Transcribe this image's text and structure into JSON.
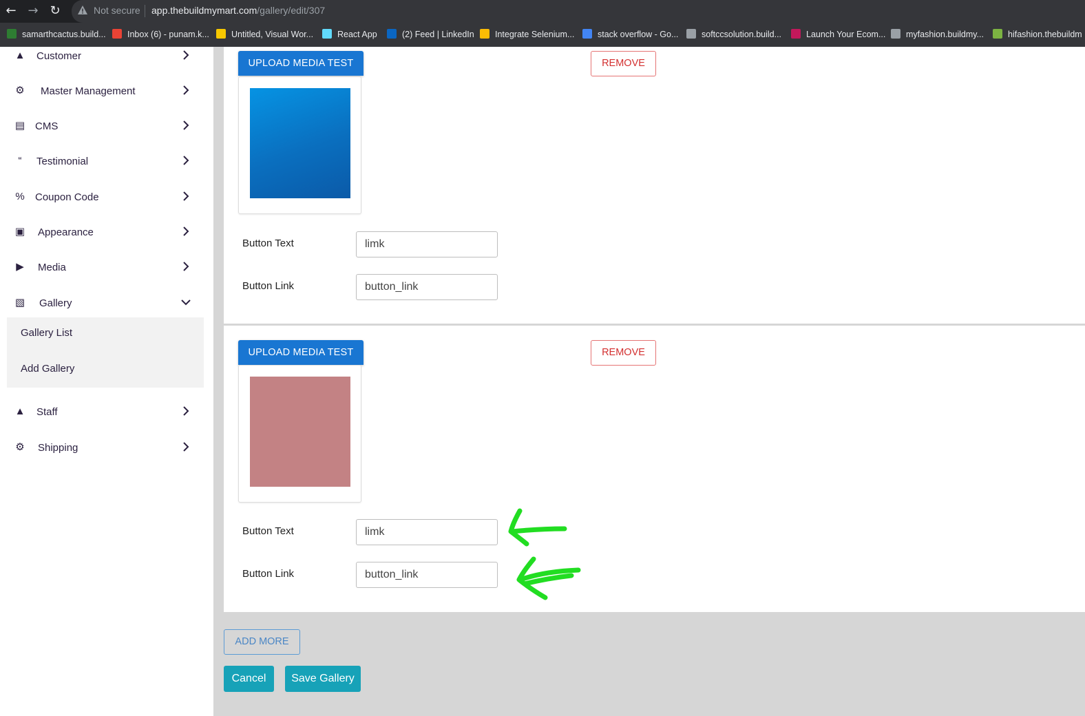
{
  "browser": {
    "not_secure": "Not secure",
    "url_host": "app.thebuildmymart.com",
    "url_path": "/gallery/edit/307",
    "bookmarks": [
      {
        "label": "samarthcactus.build...",
        "icon": "site-icon",
        "color": "#2e7d32"
      },
      {
        "label": "Inbox (6) - punam.k...",
        "icon": "gmail-icon",
        "color": "#ea4335"
      },
      {
        "label": "Untitled, Visual Wor...",
        "icon": "miro-icon",
        "color": "#f7c800"
      },
      {
        "label": "React App",
        "icon": "react-icon",
        "color": "#61dafb"
      },
      {
        "label": "(2) Feed | LinkedIn",
        "icon": "linkedin-icon",
        "color": "#0a66c2"
      },
      {
        "label": "Integrate Selenium...",
        "icon": "chrome-icon",
        "color": "#fbbc05"
      },
      {
        "label": "stack overflow - Go...",
        "icon": "google-icon",
        "color": "#4285f4"
      },
      {
        "label": "softccsolution.build...",
        "icon": "globe-icon",
        "color": "#9aa0a6"
      },
      {
        "label": "Launch Your Ecom...",
        "icon": "store-icon",
        "color": "#c2185b"
      },
      {
        "label": "myfashion.buildmy...",
        "icon": "globe-icon",
        "color": "#9aa0a6"
      },
      {
        "label": "hifashion.thebuildm",
        "icon": "leaf-icon",
        "color": "#7cb342"
      }
    ]
  },
  "sidebar": {
    "items": [
      {
        "label": "Customer",
        "icon": "user-icon",
        "glyph": "▲"
      },
      {
        "label": "Master Management",
        "icon": "user-gear-icon",
        "glyph": "⚙"
      },
      {
        "label": "CMS",
        "icon": "document-icon",
        "glyph": "▤"
      },
      {
        "label": "Testimonial",
        "icon": "quote-icon",
        "glyph": "“"
      },
      {
        "label": "Coupon Code",
        "icon": "percent-icon",
        "glyph": "%"
      },
      {
        "label": "Appearance",
        "icon": "image-icon",
        "glyph": "▣"
      },
      {
        "label": "Media",
        "icon": "play-circle-icon",
        "glyph": "▶"
      },
      {
        "label": "Gallery",
        "icon": "gallery-icon",
        "glyph": "▧"
      },
      {
        "label": "Staff",
        "icon": "user-icon",
        "glyph": "▲"
      },
      {
        "label": "Shipping",
        "icon": "gear-icon",
        "glyph": "⚙"
      }
    ],
    "gallery_submenu": [
      "Gallery List",
      "Add Gallery"
    ]
  },
  "cards": [
    {
      "upload_label": "UPLOAD MEDIA TEST",
      "remove_label": "REMOVE",
      "thumb_color": "#0a7fd0",
      "button_text_label": "Button Text",
      "button_text_value": "limk",
      "button_link_label": "Button Link",
      "button_link_value": "button_link"
    },
    {
      "upload_label": "UPLOAD MEDIA TEST",
      "remove_label": "REMOVE",
      "thumb_color": "#c38284",
      "button_text_label": "Button Text",
      "button_text_value": "limk",
      "button_link_label": "Button Link",
      "button_link_value": "button_link"
    }
  ],
  "actions": {
    "add_more": "ADD MORE",
    "cancel": "Cancel",
    "save": "Save Gallery"
  },
  "colors": {
    "primary": "#1976d2",
    "remove": "#d32f2f",
    "action": "#17a2b8",
    "annotation": "#22dd22"
  }
}
